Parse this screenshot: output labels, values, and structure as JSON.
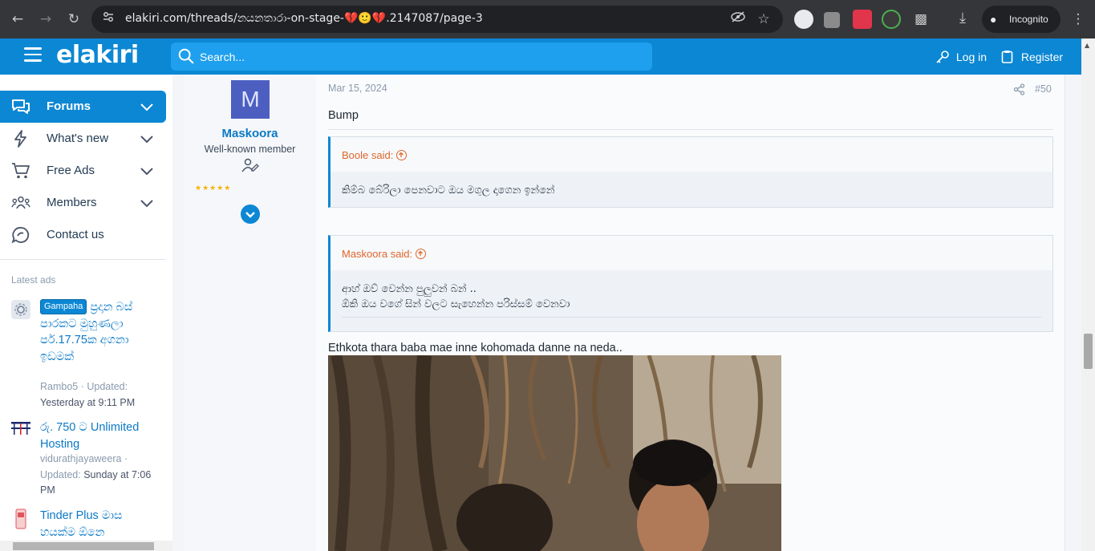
{
  "browser": {
    "url": "elakiri.com/threads/නයනතාරා-on-stage-💔🙂💔.2147087/page-3",
    "incognito_label": "Incognito"
  },
  "header": {
    "logo": "elakiri",
    "search_placeholder": "Search...",
    "login_label": "Log in",
    "register_label": "Register"
  },
  "sidebar": {
    "nav": [
      {
        "label": "Forums",
        "icon": "forums-icon"
      },
      {
        "label": "What's new",
        "icon": "bolt-icon"
      },
      {
        "label": "Free Ads",
        "icon": "cart-icon"
      },
      {
        "label": "Members",
        "icon": "members-icon"
      },
      {
        "label": "Contact us",
        "icon": "contact-icon"
      }
    ],
    "latest_ads_title": "Latest ads",
    "ads": [
      {
        "badge": "Gampaha",
        "title": "ප්‍රදාන බස් පාරකට මුහුණලා පර්.17.75ක අගනා ඉඩමක්",
        "author": "Rambo5",
        "updated_prefix": "· Updated:",
        "updated": "Yesterday at 9:11 PM"
      },
      {
        "title": "රු. 750 ට Unlimited Hosting",
        "author": "vidurathjayaweera",
        "updated_prefix": "· Updated:",
        "updated": "Sunday at 7:06 PM"
      },
      {
        "title": "Tinder Plus මාස හයක්ම ඕනෙ"
      }
    ]
  },
  "post": {
    "avatar_letter": "M",
    "username": "Maskoora",
    "user_title": "Well-known member",
    "stars": "★★★★★",
    "date": "Mar 15, 2024",
    "post_number": "#50",
    "text_1": "Bump",
    "quotes": [
      {
        "author": "Boole said:",
        "lines": [
          "කිම්බ බේරිලා පෙනවාට ඔය මගුල දාගෙන ඉන්නේ"
        ]
      },
      {
        "author": "Maskoora said:",
        "lines": [
          "ආහ් ඔව් වෙන්න පුලුවන් බන් ..",
          "ඕකි ඔය වගේ සින් වලට සැහෙන්න පරිස්සම් වෙනවා"
        ]
      }
    ],
    "text_2": "Ethkota thara baba mae inne kohomada danne na neda.."
  }
}
